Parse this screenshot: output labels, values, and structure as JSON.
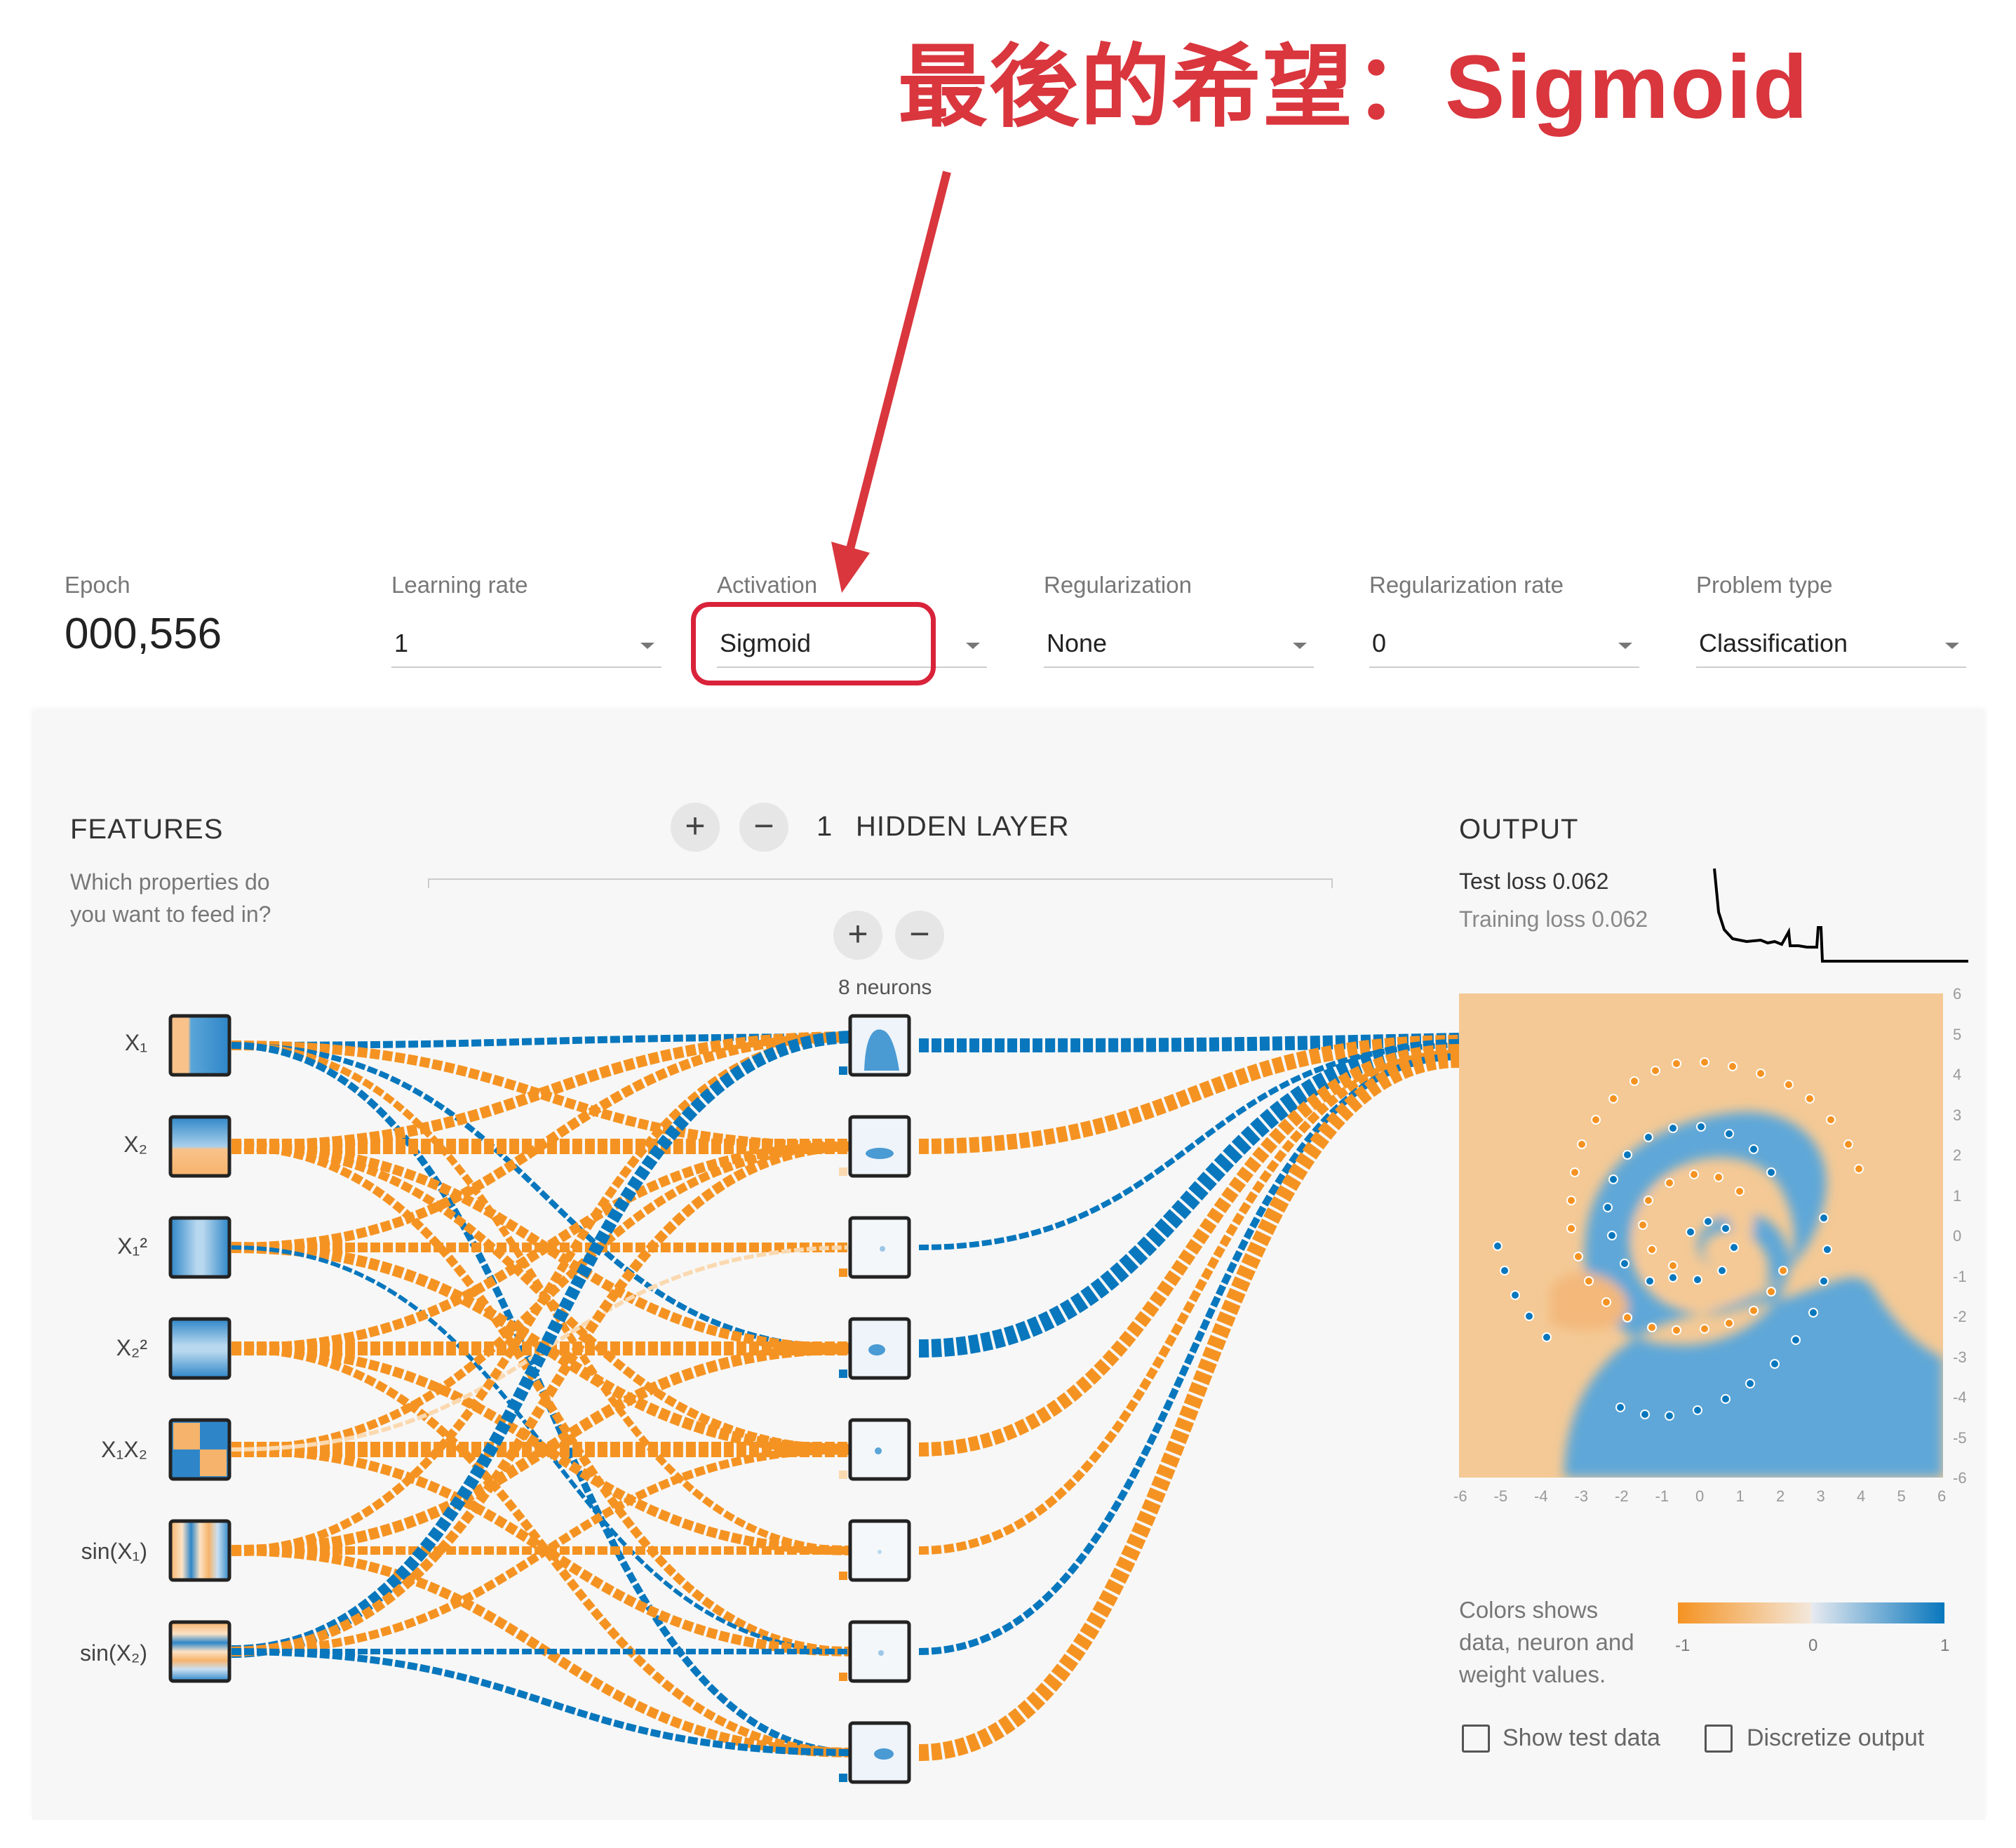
{
  "annotation": {
    "title": "最後的希望：Sigmoid"
  },
  "controls": {
    "epoch": {
      "label": "Epoch",
      "value": "000,556"
    },
    "learning_rate": {
      "label": "Learning rate",
      "value": "1"
    },
    "activation": {
      "label": "Activation",
      "value": "Sigmoid"
    },
    "regularization": {
      "label": "Regularization",
      "value": "None"
    },
    "regularization_rate": {
      "label": "Regularization rate",
      "value": "0"
    },
    "problem_type": {
      "label": "Problem type",
      "value": "Classification"
    }
  },
  "features": {
    "heading": "FEATURES",
    "subtitle_line1": "Which properties do",
    "subtitle_line2": "you want to feed in?",
    "items": [
      "X₁",
      "X₂",
      "X₁²",
      "X₂²",
      "X₁X₂",
      "sin(X₁)",
      "sin(X₂)"
    ]
  },
  "hidden": {
    "add_layer": "+",
    "remove_layer": "−",
    "count": "1",
    "label": "HIDDEN LAYER",
    "add_neuron": "+",
    "remove_neuron": "−",
    "neurons_label": "8 neurons"
  },
  "output": {
    "heading": "OUTPUT",
    "test_loss": "Test loss 0.062",
    "training_loss": "Training loss 0.062",
    "y_ticks": [
      "6",
      "5",
      "4",
      "3",
      "2",
      "1",
      "0",
      "-1",
      "-2",
      "-3",
      "-4",
      "-5",
      "-6"
    ],
    "x_ticks": [
      "-6",
      "-5",
      "-4",
      "-3",
      "-2",
      "-1",
      "0",
      "1",
      "2",
      "3",
      "4",
      "5",
      "6"
    ],
    "legend_line1": "Colors shows",
    "legend_line2": "data, neuron and",
    "legend_line3": "weight values.",
    "legend_min": "-1",
    "legend_mid": "0",
    "legend_max": "1",
    "show_test_data": "Show test data",
    "discretize_output": "Discretize output"
  },
  "colors": {
    "orange": "#f59322",
    "blue": "#0877bd",
    "annotation_red": "#d9363e"
  }
}
